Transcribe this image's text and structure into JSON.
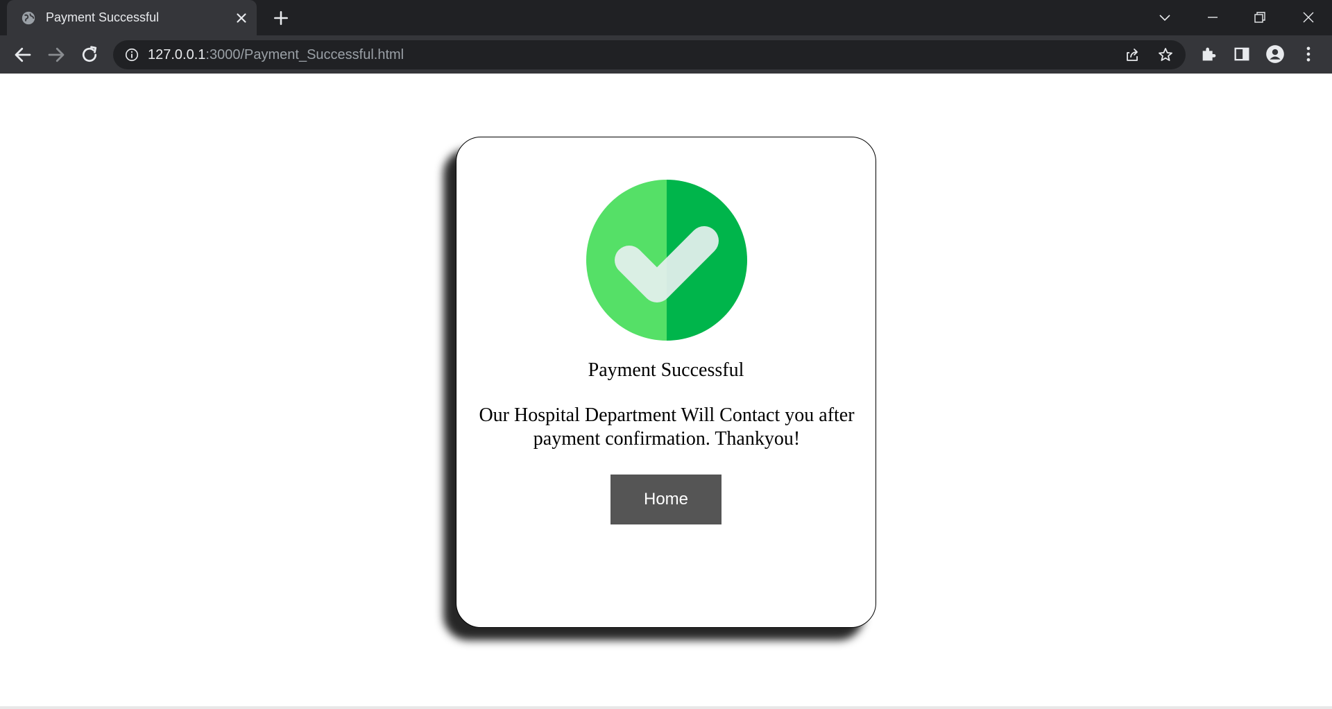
{
  "browser": {
    "tab_title": "Payment Successful",
    "url_host": "127.0.0.1",
    "url_path": ":3000/Payment_Successful.html"
  },
  "icons": {
    "favicon": "globe-icon",
    "back": "arrow-left-icon",
    "forward": "arrow-right-icon",
    "reload": "reload-icon",
    "share": "share-icon",
    "bookmark": "star-icon",
    "extensions": "puzzle-icon",
    "sidepanel": "side-panel-icon",
    "profile": "profile-icon",
    "menu": "kebab-menu-icon",
    "success": "check-circle-icon"
  },
  "card": {
    "title": "Payment Successful",
    "message": "Our Hospital Department Will Contact you after payment confirmation. Thankyou!",
    "button_label": "Home"
  },
  "colors": {
    "check_light_green": "#55e067",
    "check_dark_green": "#00b54b",
    "button_bg": "#555555"
  }
}
